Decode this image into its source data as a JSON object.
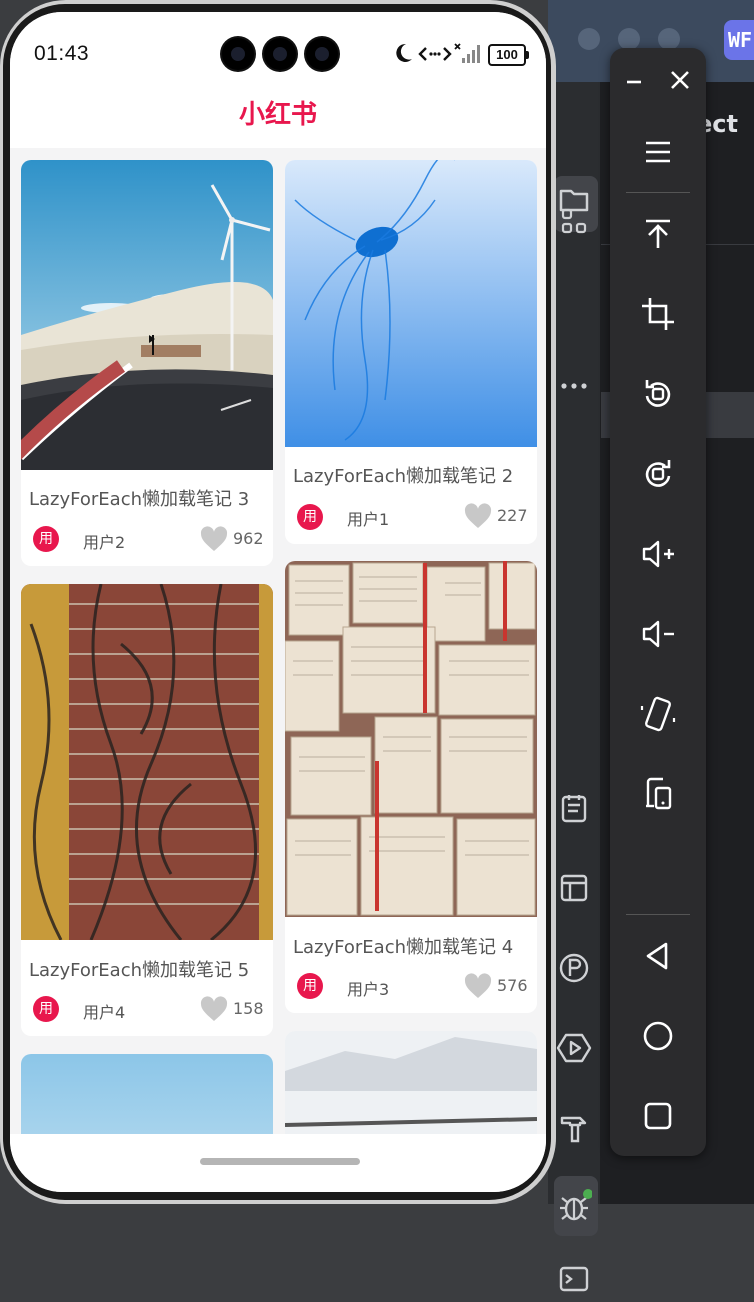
{
  "status_bar": {
    "time": "01:43",
    "battery": "100"
  },
  "app": {
    "title": "小红书",
    "accent_color": "#e8174d"
  },
  "feed": {
    "left_column": [
      {
        "title": "LazyForEach懒加载笔记 3",
        "avatar": "用",
        "user": "用户2",
        "likes": "962",
        "image": "road-windmill-photo"
      },
      {
        "title": "LazyForEach懒加载笔记 5",
        "avatar": "用",
        "user": "用户4",
        "likes": "158",
        "image": "brick-wall-vines-photo"
      },
      {
        "image": "sky-photo-partial"
      }
    ],
    "right_column": [
      {
        "title": "LazyForEach懒加载笔记 2",
        "avatar": "用",
        "user": "用户1",
        "likes": "227",
        "image": "jellyfish-photo"
      },
      {
        "title": "LazyForEach懒加载笔记 4",
        "avatar": "用",
        "user": "用户3",
        "likes": "576",
        "image": "open-books-photo"
      },
      {
        "image": "snow-landscape-photo-partial"
      }
    ]
  },
  "ide": {
    "title_fragment": "ect",
    "badge": "WF"
  },
  "emulator_toolbar": {
    "buttons": [
      "minimize-icon",
      "close-icon",
      "menu-icon",
      "pin-top-icon",
      "screenshot-crop-icon",
      "rotate-left-icon",
      "rotate-right-icon",
      "volume-up-icon",
      "volume-down-icon",
      "fold-icon",
      "device-switch-icon",
      "back-icon",
      "home-icon",
      "recents-icon"
    ]
  }
}
